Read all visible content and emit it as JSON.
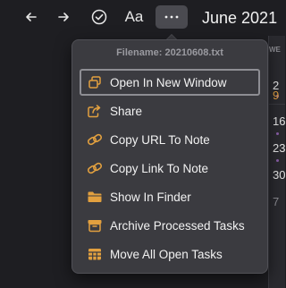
{
  "toolbar": {
    "back_icon": "arrow-left-icon",
    "forward_icon": "arrow-right-icon",
    "check_icon": "circle-check-icon",
    "font_label": "Aa",
    "more_icon": "ellipsis-icon"
  },
  "calendar": {
    "title": "June 2021",
    "weekday_header": "WE",
    "visible_days": [
      "2",
      "9",
      "16",
      "23",
      "30",
      "7"
    ]
  },
  "menu": {
    "header": "Filename: 20210608.txt",
    "accent_color": "#e2a03f",
    "items": [
      {
        "label": "Open In New Window",
        "icon": "window-stack-icon",
        "selected": true
      },
      {
        "label": "Share",
        "icon": "share-icon",
        "selected": false
      },
      {
        "label": "Copy URL To Note",
        "icon": "link-icon",
        "selected": false
      },
      {
        "label": "Copy Link To Note",
        "icon": "link-icon",
        "selected": false
      },
      {
        "label": "Show In Finder",
        "icon": "folder-icon",
        "selected": false
      },
      {
        "label": "Archive Processed Tasks",
        "icon": "archive-box-icon",
        "selected": false
      },
      {
        "label": "Move All Open Tasks",
        "icon": "calendar-grid-icon",
        "selected": false
      }
    ]
  }
}
